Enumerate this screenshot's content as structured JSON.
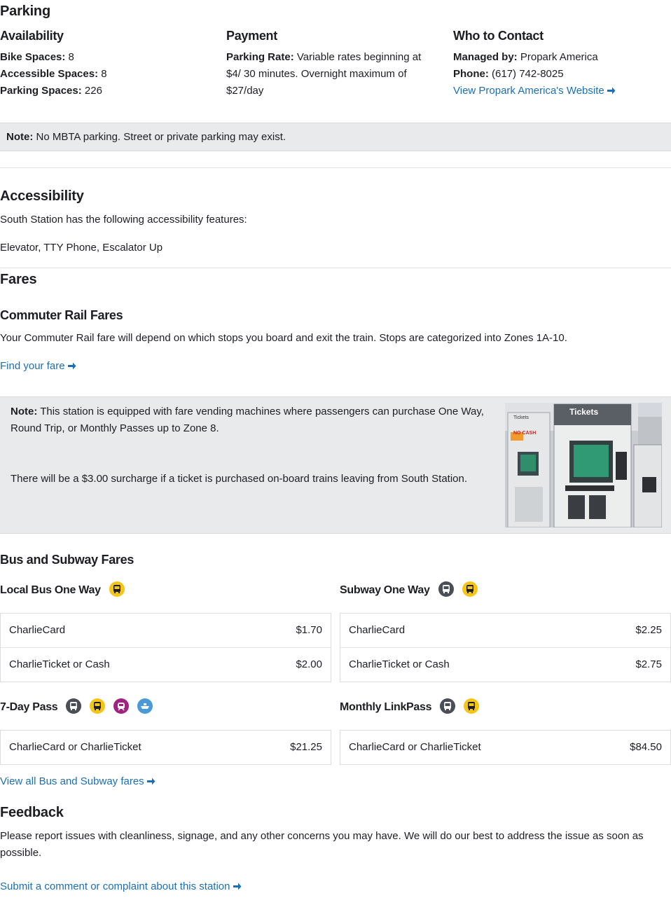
{
  "parking": {
    "title": "Parking",
    "availability": {
      "heading": "Availability",
      "bike_label": "Bike Spaces:",
      "bike_value": " 8",
      "accessible_label": "Accessible Spaces:",
      "accessible_value": " 8",
      "parking_label": "Parking Spaces:",
      "parking_value": " 226"
    },
    "payment": {
      "heading": "Payment",
      "rate_label": "Parking Rate:",
      "rate_line1": " Variable rates beginning at",
      "rate_line2": "$4/ 30 minutes. Overnight maximum of",
      "rate_line3": "$27/day"
    },
    "contact": {
      "heading": "Who to Contact",
      "managed_label": "Managed by:",
      "managed_value": " Propark America",
      "phone_label": "Phone:",
      "phone_value": " (617) 742-8025",
      "website_link": "View Propark America's Website"
    },
    "note_label": "Note:",
    "note_text": " No MBTA parking. Street or private parking may exist."
  },
  "accessibility": {
    "title": "Accessibility",
    "intro": "South Station has the following accessibility features:",
    "features": "Elevator, TTY Phone, Escalator Up"
  },
  "fares": {
    "title": "Fares",
    "commuter": {
      "heading": "Commuter Rail Fares",
      "text": "Your Commuter Rail fare will depend on which stops you board and exit the train. Stops are categorized into Zones 1A-10.",
      "link": "Find your fare",
      "note_label": "Note:",
      "note_line1": " This station is equipped with fare vending machines where passengers can purchase One Way,",
      "note_line2": "Round Trip, or Monthly Passes up to Zone 8.",
      "surcharge": "There will be a $3.00 surcharge if a ticket is purchased on-board trains leaving from South Station.",
      "photo_sign": "Tickets",
      "photo_no_cash": "NO CASH",
      "photo_small_sign": "Tickets"
    },
    "bus_subway": {
      "heading": "Bus and Subway Fares",
      "groups": [
        {
          "title": "Local Bus One Way",
          "icons": [
            "bus-icon"
          ],
          "rows": [
            {
              "label": "CharlieCard",
              "price": "$1.70"
            },
            {
              "label": "CharlieTicket or Cash",
              "price": "$2.00"
            }
          ]
        },
        {
          "title": "Subway One Way",
          "icons": [
            "subway-icon",
            "bus-icon"
          ],
          "rows": [
            {
              "label": "CharlieCard",
              "price": "$2.25"
            },
            {
              "label": "CharlieTicket or Cash",
              "price": "$2.75"
            }
          ]
        },
        {
          "title": "7-Day Pass",
          "icons": [
            "subway-icon",
            "bus-icon",
            "commuter-rail-icon",
            "ferry-icon"
          ],
          "rows": [
            {
              "label": "CharlieCard or CharlieTicket",
              "price": "$21.25"
            }
          ]
        },
        {
          "title": "Monthly LinkPass",
          "icons": [
            "subway-icon",
            "bus-icon"
          ],
          "rows": [
            {
              "label": "CharlieCard or CharlieTicket",
              "price": "$84.50"
            }
          ]
        }
      ],
      "view_all_link": "View all Bus and Subway fares"
    }
  },
  "feedback": {
    "title": "Feedback",
    "text": "Please report issues with cleanliness, signage, and any other concerns you may have. We will do our best to address the issue as soon as possible.",
    "link": "Submit a comment or complaint about this station"
  },
  "colors": {
    "link": "#1c6fb5",
    "bus": "#f5c518",
    "subway": "#4a4e56",
    "commuter_rail": "#a0247f",
    "ferry": "#4a9ad9",
    "note_bg": "#e9eaec"
  }
}
